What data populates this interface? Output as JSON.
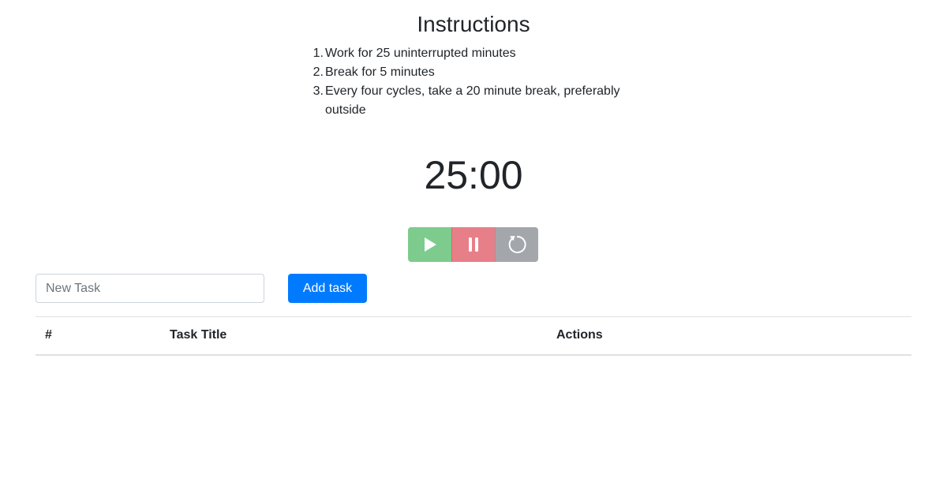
{
  "instructions": {
    "title": "Instructions",
    "steps": [
      {
        "num": "1.",
        "text": "Work for 25 uninterrupted minutes"
      },
      {
        "num": "2.",
        "text": "Break for 5 minutes"
      },
      {
        "num": "3.",
        "text": "Every four cycles, take a 20 minute break, preferably outside"
      }
    ]
  },
  "timer": {
    "display": "25:00"
  },
  "controls": {
    "play_icon": "play-icon",
    "pause_icon": "pause-icon",
    "reset_icon": "reset-icon",
    "play_color": "#7dcb8d",
    "pause_color": "#e77f88",
    "reset_color": "#a3a7ab"
  },
  "task_form": {
    "placeholder": "New Task",
    "value": "",
    "add_label": "Add task",
    "add_color": "#007bff"
  },
  "task_table": {
    "headers": [
      "#",
      "Task Title",
      "Actions"
    ],
    "rows": []
  }
}
